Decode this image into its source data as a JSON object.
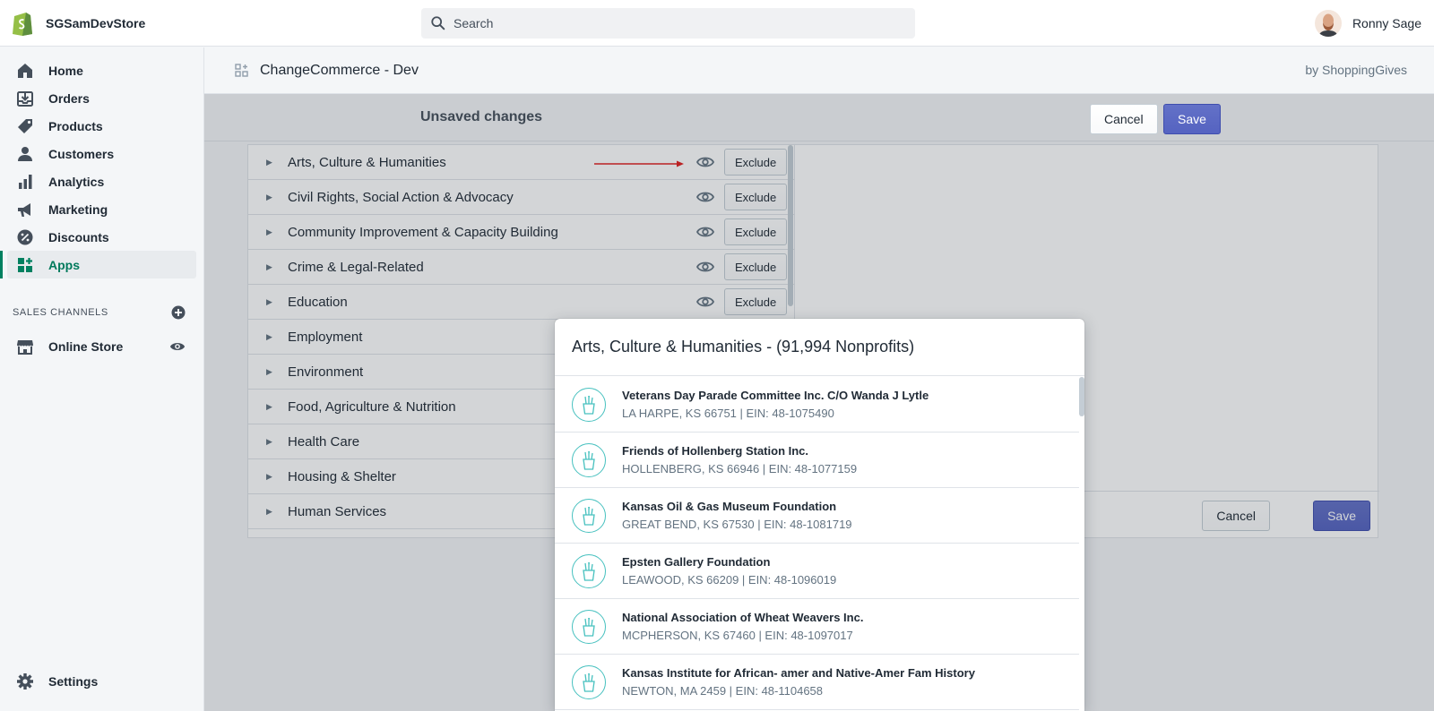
{
  "topbar": {
    "store_name": "SGSamDevStore",
    "search_placeholder": "Search",
    "user_name": "Ronny Sage"
  },
  "sidebar": {
    "items": [
      {
        "label": "Home",
        "icon": "home-icon"
      },
      {
        "label": "Orders",
        "icon": "orders-icon"
      },
      {
        "label": "Products",
        "icon": "tag-icon"
      },
      {
        "label": "Customers",
        "icon": "person-icon"
      },
      {
        "label": "Analytics",
        "icon": "bar-chart-icon"
      },
      {
        "label": "Marketing",
        "icon": "megaphone-icon"
      },
      {
        "label": "Discounts",
        "icon": "discount-icon"
      },
      {
        "label": "Apps",
        "icon": "apps-icon",
        "active": true
      }
    ],
    "sales_channels_label": "SALES CHANNELS",
    "online_store_label": "Online Store",
    "settings_label": "Settings"
  },
  "app_header": {
    "title": "ChangeCommerce - Dev",
    "by": "by ShoppingGives"
  },
  "unsaved_bar": {
    "message": "Unsaved changes",
    "cancel_label": "Cancel",
    "save_label": "Save"
  },
  "categories": [
    {
      "label": "Arts, Culture & Humanities",
      "action": "Exclude"
    },
    {
      "label": "Civil Rights, Social Action & Advocacy",
      "action": "Exclude"
    },
    {
      "label": "Community Improvement & Capacity Building",
      "action": "Exclude"
    },
    {
      "label": "Crime & Legal-Related",
      "action": "Exclude"
    },
    {
      "label": "Education",
      "action": "Exclude"
    },
    {
      "label": "Employment"
    },
    {
      "label": "Environment"
    },
    {
      "label": "Food, Agriculture & Nutrition"
    },
    {
      "label": "Health Care"
    },
    {
      "label": "Housing & Shelter"
    },
    {
      "label": "Human Services"
    }
  ],
  "card_footer": {
    "cancel_label": "Cancel",
    "save_label": "Save"
  },
  "modal": {
    "title": "Arts, Culture & Humanities - (91,994 Nonprofits)",
    "nonprofits": [
      {
        "name": "Veterans Day Parade Committee Inc. C/O Wanda J Lytle",
        "meta": "LA HARPE, KS 66751 | EIN: 48-1075490"
      },
      {
        "name": "Friends of Hollenberg Station Inc.",
        "meta": "HOLLENBERG, KS 66946 | EIN: 48-1077159"
      },
      {
        "name": "Kansas Oil & Gas Museum Foundation",
        "meta": "GREAT BEND, KS 67530 | EIN: 48-1081719"
      },
      {
        "name": "Epsten Gallery Foundation",
        "meta": "LEAWOOD, KS 66209 | EIN: 48-1096019"
      },
      {
        "name": "National Association of Wheat Weavers Inc.",
        "meta": "MCPHERSON, KS 67460 | EIN: 48-1097017"
      },
      {
        "name": "Kansas Institute for African- amer and Native-Amer Fam History",
        "meta": "NEWTON, MA 2459 | EIN: 48-1104658"
      }
    ]
  },
  "colors": {
    "brand_green": "#008060",
    "primary_button": "#5c6ac4",
    "icon_teal": "#47c1bf",
    "annotation_arrow": "#e02020"
  }
}
